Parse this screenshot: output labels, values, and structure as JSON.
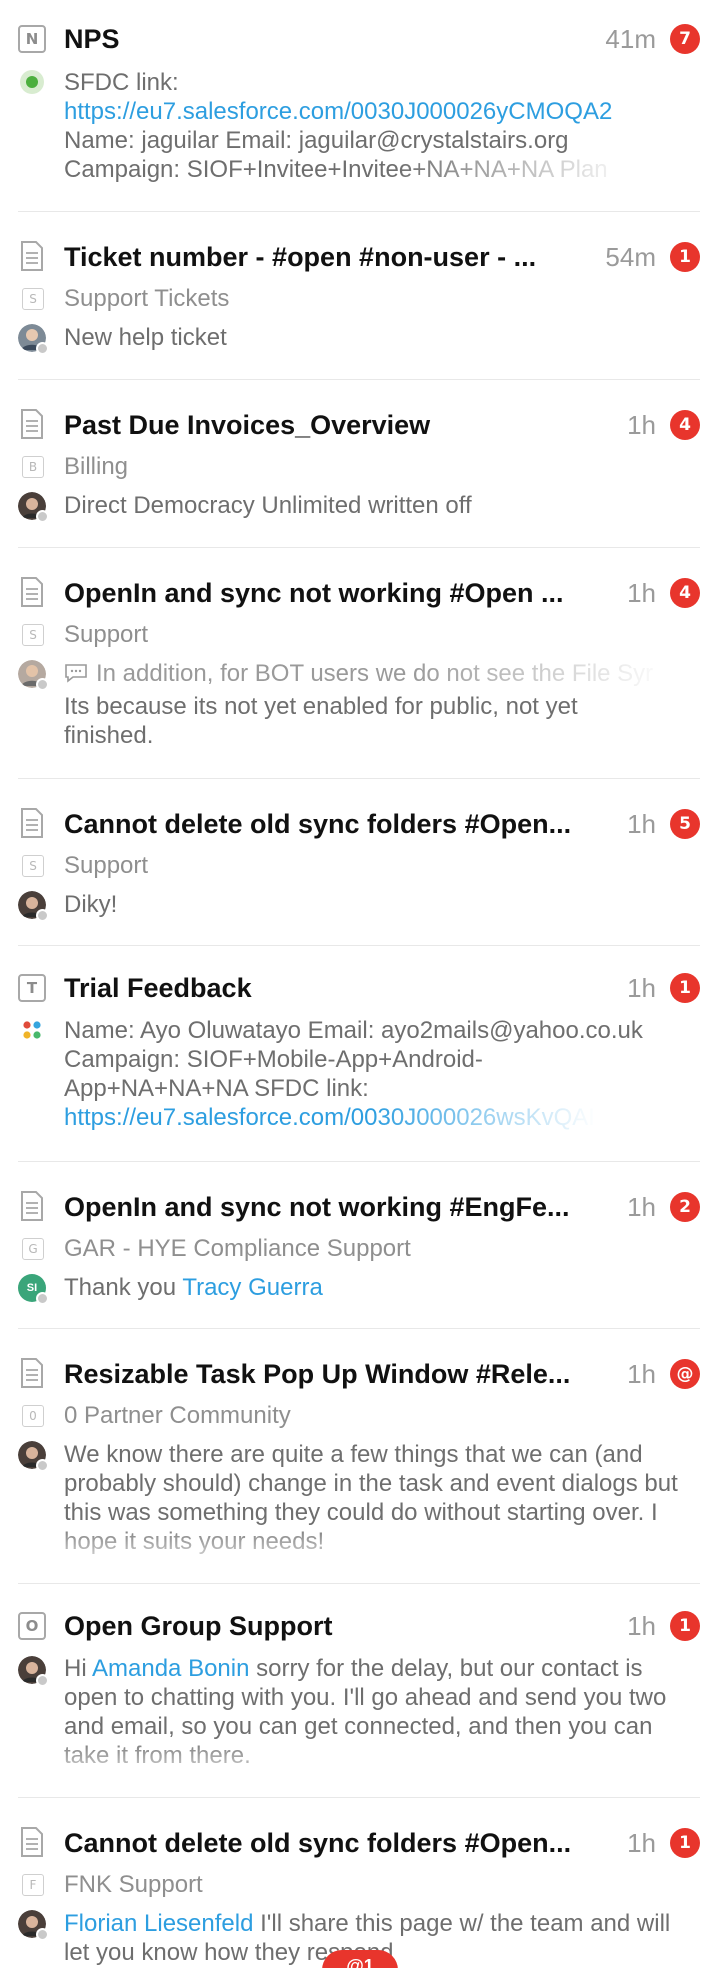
{
  "items": [
    {
      "title": "NPS",
      "icon_letter": "N",
      "time": "41m",
      "badge": "7",
      "lines": [
        "SFDC link:",
        "https://eu7.salesforce.com/0030J000026yCMOQA2",
        "Name:  jaguilar Email: jaguilar@crystalstairs.org",
        "Campaign: SIOF+Invitee+Invitee+NA+NA+NA Plan"
      ]
    },
    {
      "title": "Ticket number - #open #non-user - ...",
      "time": "54m",
      "badge": "1",
      "group_letter": "S",
      "group": "Support Tickets",
      "message": "New help ticket"
    },
    {
      "title": "Past Due Invoices_Overview",
      "time": "1h",
      "badge": "4",
      "group_letter": "B",
      "group": "Billing",
      "message": "Direct Democracy Unlimited written off"
    },
    {
      "title": "OpenIn and sync not working #Open ...",
      "time": "1h",
      "badge": "4",
      "group_letter": "S",
      "group": "Support",
      "comment": "In addition, for BOT users we do not see the File Syr",
      "message": "Its because its not yet enabled for public, not yet finished."
    },
    {
      "title": "Cannot delete old sync folders #Open...",
      "time": "1h",
      "badge": "5",
      "group_letter": "S",
      "group": "Support",
      "message": "Diky!"
    },
    {
      "title": "Trial Feedback",
      "icon_letter": "T",
      "time": "1h",
      "badge": "1",
      "lines": [
        "Name: Ayo Oluwatayo Email: ayo2mails@yahoo.co.uk",
        "Campaign: SIOF+Mobile-App+Android-",
        "App+NA+NA+NA SFDC link:",
        "https://eu7.salesforce.com/0030J000026wsKvQAI"
      ]
    },
    {
      "title": "OpenIn and sync not working #EngFe...",
      "time": "1h",
      "badge": "2",
      "group_letter": "G",
      "group": "GAR - HYE Compliance Support",
      "message_prefix": "Thank you ",
      "message_link": "Tracy Guerra",
      "avatar_initials": "SI"
    },
    {
      "title": "Resizable Task Pop Up Window #Rele...",
      "time": "1h",
      "badge": "@",
      "group_letter": "0",
      "group": "0 Partner Community",
      "message": "We know there are quite a few things that we can (and probably should) change in the task and event dialogs but this was something they could do without starting over. I hope it suits your needs!"
    },
    {
      "title": "Open Group Support",
      "icon_letter": "O",
      "time": "1h",
      "badge": "1",
      "message_prefix": "Hi ",
      "message_link": "Amanda Bonin",
      "message_suffix": " sorry for the delay, but our contact is open to chatting with you. I'll go ahead and send you two and email, so you can get connected, and then you can take it from there."
    },
    {
      "title": "Cannot delete old sync folders #Open...",
      "time": "1h",
      "badge": "1",
      "group_letter": "F",
      "group": "FNK Support",
      "message_link": "Florian Liesenfeld",
      "message_suffix": " I'll share this page w/ the team and will let you know how they respond"
    }
  ],
  "floating_badge": "@1",
  "colors": {
    "badge": "#e8352c",
    "link": "#2d9ee0",
    "title": "#111111",
    "meta": "#8f8f8f"
  }
}
